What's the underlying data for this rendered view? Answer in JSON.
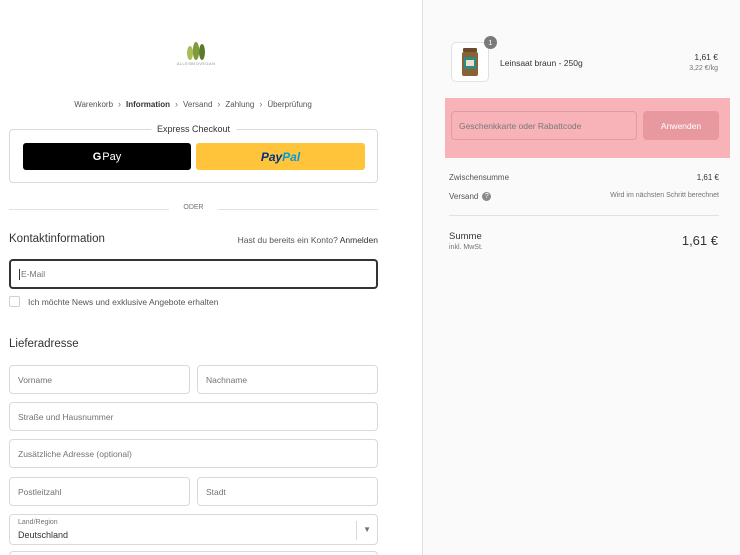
{
  "brand": {
    "logo_text": "ALLESBIOVEGAN"
  },
  "breadcrumb": [
    "Warenkorb",
    "Information",
    "Versand",
    "Zahlung",
    "Überprüfung"
  ],
  "express": {
    "title": "Express Checkout",
    "gpay_label": "Pay",
    "paypal_part1": "Pay",
    "paypal_part2": "Pal"
  },
  "divider": "ODER",
  "contact": {
    "title": "Kontaktinformation",
    "login_prompt": "Hast du bereits ein Konto?",
    "login_link": "Anmelden",
    "email_placeholder": "E-Mail",
    "newsletter_label": "Ich möchte News und exklusive Angebote erhalten"
  },
  "shipping": {
    "title": "Lieferadresse",
    "first_name": "Vorname",
    "last_name": "Nachname",
    "street": "Straße und Hausnummer",
    "address2": "Zusätzliche Adresse (optional)",
    "zip": "Postleitzahl",
    "city": "Stadt",
    "country_label": "Land/Region",
    "country_value": "Deutschland"
  },
  "cart": {
    "item": {
      "quantity": "1",
      "name": "Leinsaat braun - 250g",
      "price": "1,61 €",
      "unit_price": "3,22 €/kg"
    },
    "discount": {
      "placeholder": "Geschenkkarte oder Rabattcode",
      "apply": "Anwenden"
    },
    "subtotal_label": "Zwischensumme",
    "subtotal_value": "1,61 €",
    "shipping_label": "Versand",
    "shipping_value": "Wird im nächsten Schritt berechnet",
    "total_label": "Summe",
    "total_sub": "inkl. MwSt.",
    "total_value": "1,61 €"
  },
  "colors": {
    "discount_highlight": "#f7b3b8",
    "paypal_yellow": "#ffc439",
    "gpay_black": "#000000"
  }
}
